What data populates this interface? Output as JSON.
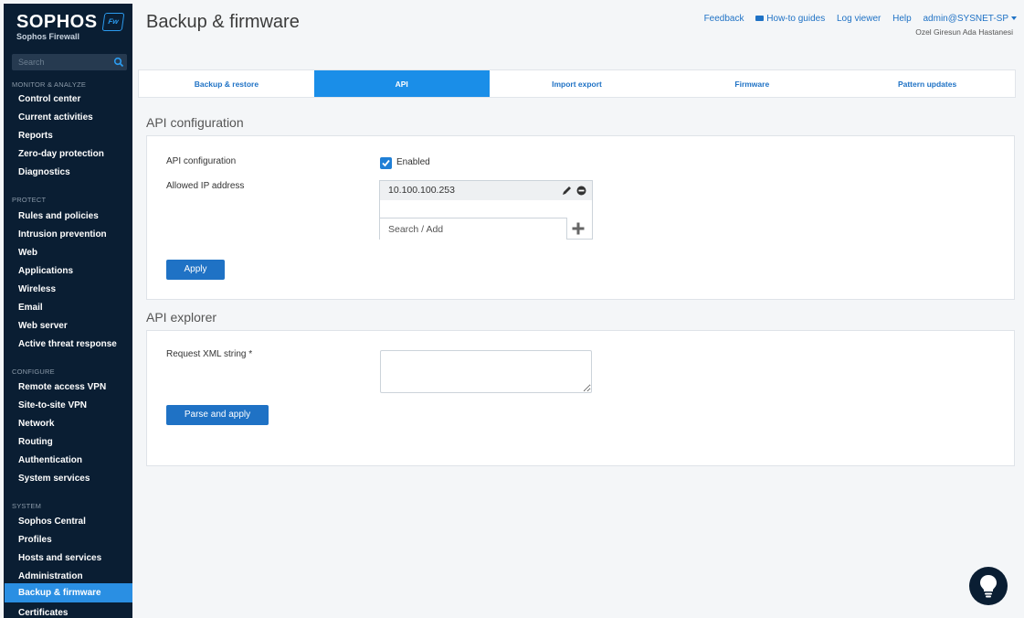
{
  "brand": {
    "name": "SOPHOS",
    "product": "Sophos Firewall",
    "badge": "Fw"
  },
  "sidebar": {
    "search_placeholder": "Search",
    "sections": {
      "monitor": "MONITOR & ANALYZE",
      "protect": "PROTECT",
      "configure": "CONFIGURE",
      "system": "SYSTEM"
    },
    "items": {
      "control_center": "Control center",
      "current_activities": "Current activities",
      "reports": "Reports",
      "zero_day": "Zero-day protection",
      "diagnostics": "Diagnostics",
      "rules": "Rules and policies",
      "intrusion": "Intrusion prevention",
      "web": "Web",
      "applications": "Applications",
      "wireless": "Wireless",
      "email": "Email",
      "web_server": "Web server",
      "active_threat": "Active threat response",
      "remote_vpn": "Remote access VPN",
      "site_vpn": "Site-to-site VPN",
      "network": "Network",
      "routing": "Routing",
      "authentication": "Authentication",
      "system_services": "System services",
      "sophos_central": "Sophos Central",
      "profiles": "Profiles",
      "hosts_services": "Hosts and services",
      "administration": "Administration",
      "backup_firmware": "Backup & firmware",
      "certificates": "Certificates"
    },
    "active_item": "Backup & firmware"
  },
  "header": {
    "title": "Backup & firmware",
    "links": {
      "feedback": "Feedback",
      "howto": "How-to guides",
      "log_viewer": "Log viewer",
      "help": "Help",
      "user": "admin@SYSNET-SP"
    },
    "org": "Ozel Giresun Ada Hastanesi"
  },
  "tabs": {
    "backup_restore": "Backup & restore",
    "api": "API",
    "import_export": "Import export",
    "firmware": "Firmware",
    "pattern_updates": "Pattern updates"
  },
  "api_config": {
    "section_title": "API configuration",
    "config_label": "API configuration",
    "enabled_label": "Enabled",
    "enabled": true,
    "allowed_ip_label": "Allowed IP address",
    "allowed_ips": [
      "10.100.100.253"
    ],
    "search_placeholder": "Search / Add",
    "apply_label": "Apply"
  },
  "api_explorer": {
    "section_title": "API explorer",
    "request_label": "Request XML string *",
    "request_value": "",
    "parse_label": "Parse and apply"
  },
  "colors": {
    "sidebar_bg": "#0a1e33",
    "accent": "#1a8ee8",
    "button": "#1f72c5",
    "link": "#1f72c5"
  },
  "icons": [
    "search-icon",
    "video-icon",
    "caret-down-icon",
    "checkmark-icon",
    "pencil-icon",
    "remove-icon",
    "plus-icon",
    "lightbulb-icon"
  ]
}
